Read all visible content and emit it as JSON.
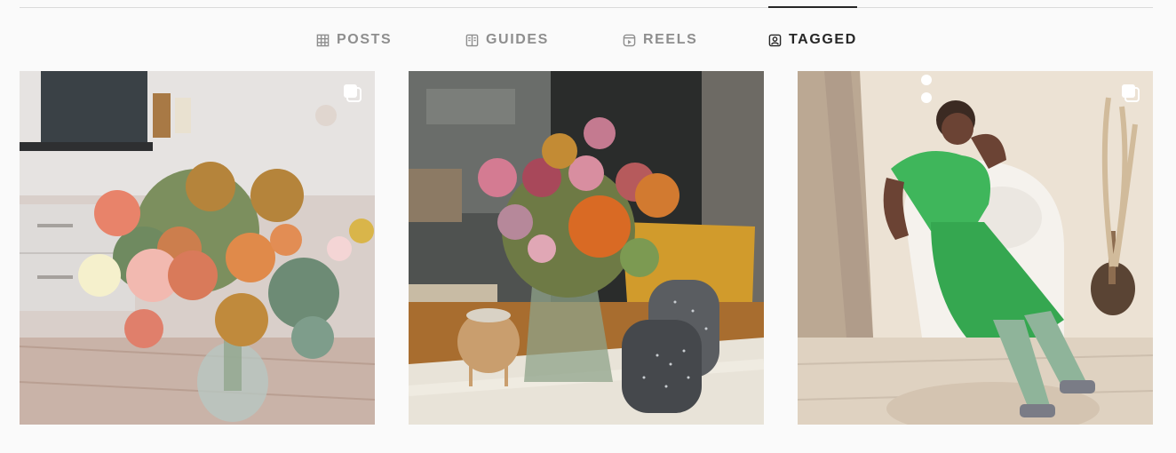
{
  "tabs": [
    {
      "label": "POSTS",
      "icon": "grid-icon",
      "active": false
    },
    {
      "label": "GUIDES",
      "icon": "guide-book-icon",
      "active": false
    },
    {
      "label": "REELS",
      "icon": "reels-icon",
      "active": false
    },
    {
      "label": "TAGGED",
      "icon": "tagged-user-icon",
      "active": true
    }
  ],
  "posts": [
    {
      "subject": "flower bouquet in glass vase on kitchen counter",
      "multi_image": true,
      "icon": "carousel-icon"
    },
    {
      "subject": "flower arrangement with candle holders on table",
      "multi_image": false
    },
    {
      "subject": "woman in green satin dress seated on white chair",
      "multi_image": true,
      "icon": "carousel-icon"
    }
  ],
  "colors": {
    "active_tab": "#262626",
    "inactive_tab": "#8e8e8e",
    "background": "#fafafa",
    "divider": "#dbdbdb"
  }
}
